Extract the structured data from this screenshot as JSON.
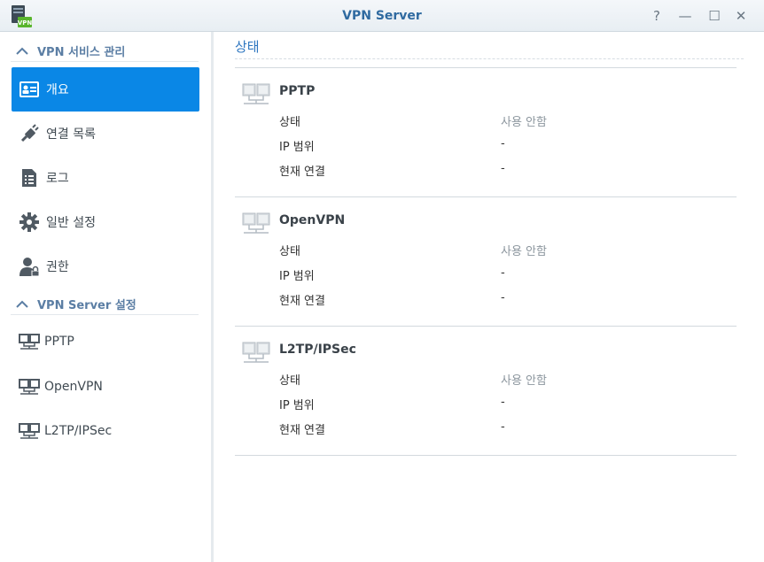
{
  "window": {
    "title": "VPN Server",
    "app_icon_label": "VPN",
    "help_glyph": "?",
    "minimize_glyph": "—",
    "maximize_glyph": "☐",
    "close_glyph": "✕"
  },
  "sidebar": {
    "section1_title": "VPN 서비스 관리",
    "section2_title": "VPN Server 설정",
    "items": [
      {
        "label": "개요",
        "icon": "overview-card-icon",
        "active": true
      },
      {
        "label": "연결 목록",
        "icon": "plug-icon",
        "active": false
      },
      {
        "label": "로그",
        "icon": "log-document-icon",
        "active": false
      },
      {
        "label": "일반 설정",
        "icon": "gear-icon",
        "active": false
      },
      {
        "label": "권한",
        "icon": "user-permission-icon",
        "active": false
      }
    ],
    "server_items": [
      {
        "label": "PPTP",
        "icon": "network-icon"
      },
      {
        "label": "OpenVPN",
        "icon": "network-icon"
      },
      {
        "label": "L2TP/IPSec",
        "icon": "network-icon"
      }
    ]
  },
  "main": {
    "title": "상태",
    "protocols": [
      {
        "name": "PPTP",
        "rows": [
          {
            "label": "상태",
            "value": "사용 안함"
          },
          {
            "label": "IP 범위",
            "value": "-"
          },
          {
            "label": "현재 연결",
            "value": "-"
          }
        ]
      },
      {
        "name": "OpenVPN",
        "rows": [
          {
            "label": "상태",
            "value": "사용 안함"
          },
          {
            "label": "IP 범위",
            "value": "-"
          },
          {
            "label": "현재 연결",
            "value": "-"
          }
        ]
      },
      {
        "name": "L2TP/IPSec",
        "rows": [
          {
            "label": "상태",
            "value": "사용 안함"
          },
          {
            "label": "IP 범위",
            "value": "-"
          },
          {
            "label": "현재 연결",
            "value": "-"
          }
        ]
      }
    ]
  },
  "colors": {
    "accent": "#0a87e6",
    "title_blue": "#2f6aa0",
    "section_blue": "#5b7ea4",
    "muted_text": "#8c969e"
  }
}
